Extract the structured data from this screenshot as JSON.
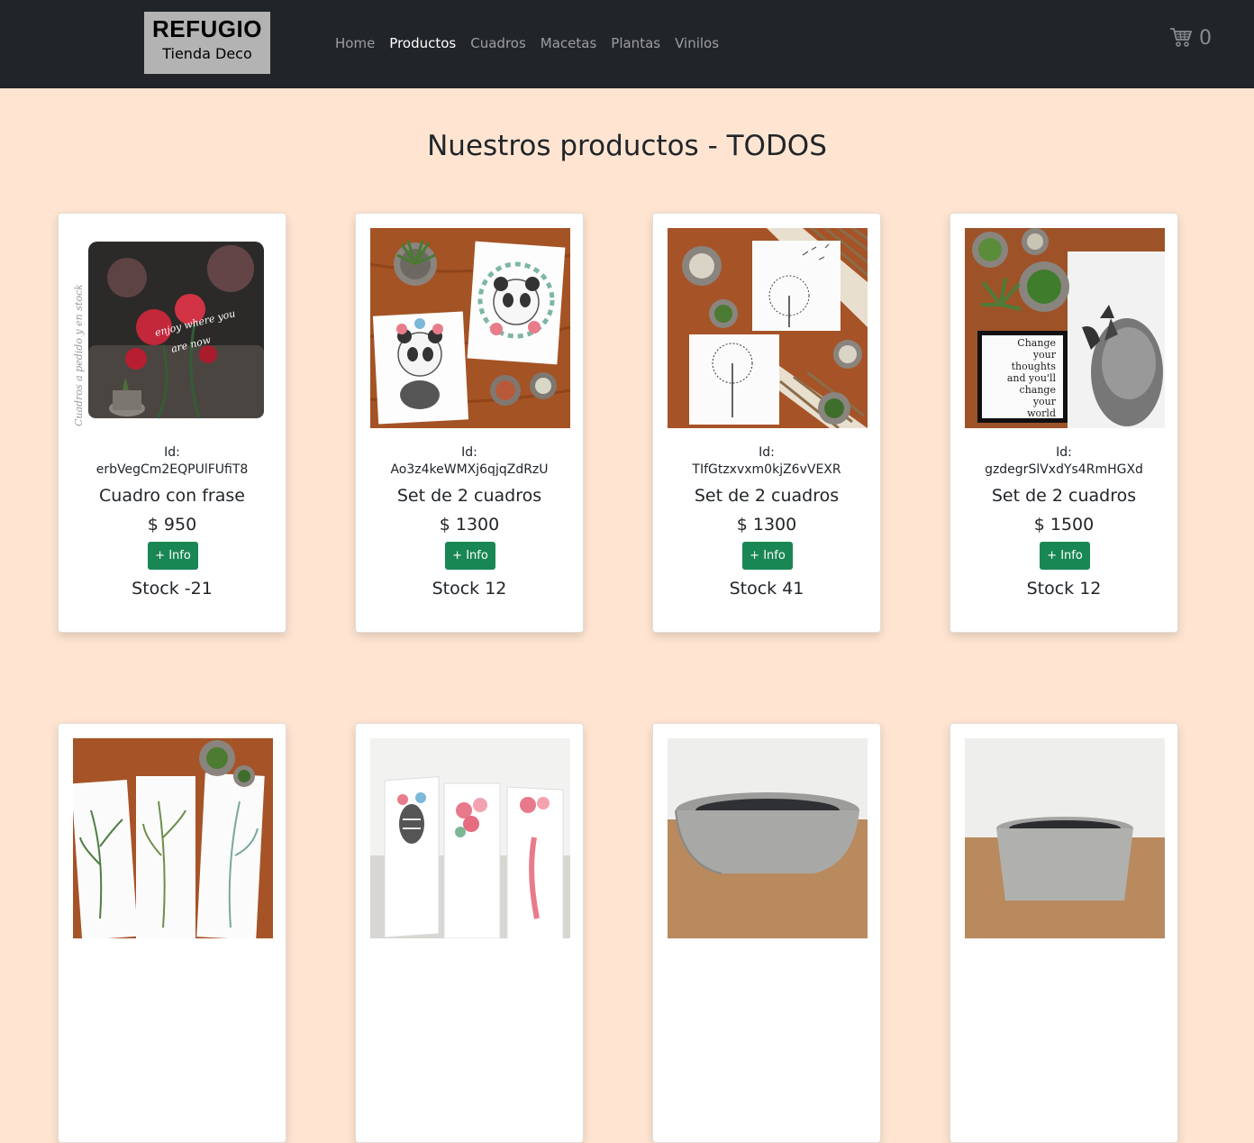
{
  "navbar": {
    "logo_title": "REFUGIO",
    "logo_subtitle": "Tienda Deco",
    "links": [
      "Home",
      "Productos",
      "Cuadros",
      "Macetas",
      "Plantas",
      "Vinilos"
    ],
    "active_link": "Productos",
    "cart_count": "0"
  },
  "page_title": "Nuestros productos - TODOS",
  "id_label": "Id:",
  "info_button_label": "+ Info",
  "products": [
    {
      "id": "erbVegCm2EQPUlFUfiT8",
      "name": "Cuadro con frase",
      "price": "$ 950",
      "stock": "Stock -21",
      "image_text": "Cuadros a pedido y en stock"
    },
    {
      "id": "Ao3z4keWMXj6qjqZdRzU",
      "name": "Set de 2 cuadros",
      "price": "$ 1300",
      "stock": "Stock 12"
    },
    {
      "id": "TIfGtzxvxm0kjZ6vVEXR",
      "name": "Set de 2 cuadros",
      "price": "$ 1300",
      "stock": "Stock 41"
    },
    {
      "id": "gzdegrSlVxdYs4RmHGXd",
      "name": "Set de 2 cuadros",
      "price": "$ 1500",
      "stock": "Stock 12",
      "image_text": [
        "Change",
        "your",
        "thoughts",
        "and you'll",
        "change",
        "your",
        "world"
      ]
    },
    {
      "image": "leaf-prints"
    },
    {
      "image": "animal-prints"
    },
    {
      "image": "concrete-bowl"
    },
    {
      "image": "concrete-pot"
    }
  ],
  "colors": {
    "background": "#ffe5d1",
    "navbar": "#212529",
    "button": "#198754",
    "logo_box": "#b3b3b3"
  },
  "icons": {
    "cart": "cart-icon"
  }
}
